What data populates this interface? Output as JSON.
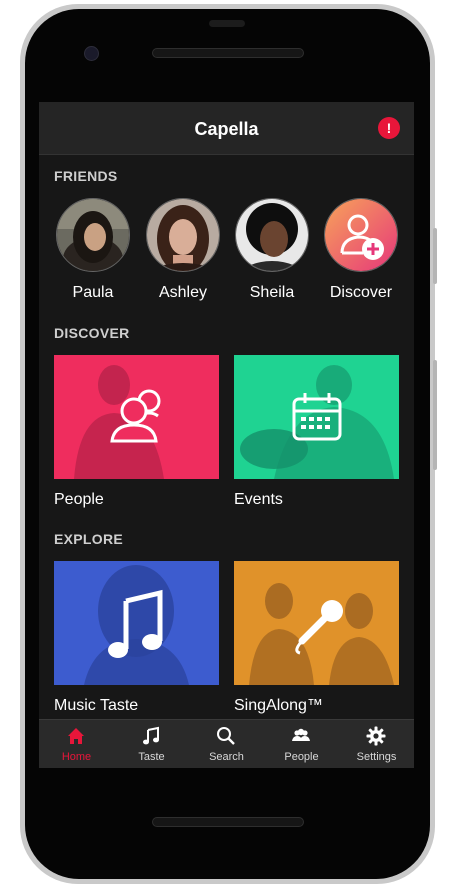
{
  "app": {
    "title": "Capella",
    "alert_symbol": "!"
  },
  "sections": {
    "friends": "FRIENDS",
    "discover": "DISCOVER",
    "explore": "EXPLORE"
  },
  "friends": [
    {
      "name": "Paula"
    },
    {
      "name": "Ashley"
    },
    {
      "name": "Sheila"
    },
    {
      "name": "Discover"
    }
  ],
  "discover_tiles": [
    {
      "label": "People",
      "color": "#ef2d5e"
    },
    {
      "label": "Events",
      "color": "#1fd392"
    }
  ],
  "explore_tiles": [
    {
      "label": "Music Taste",
      "color": "#3d5ccf"
    },
    {
      "label": "SingAlong™",
      "color": "#e0922a"
    }
  ],
  "tabs": [
    {
      "label": "Home",
      "icon": "home-icon",
      "active": true
    },
    {
      "label": "Taste",
      "icon": "music-note-icon"
    },
    {
      "label": "Search",
      "icon": "search-icon"
    },
    {
      "label": "People",
      "icon": "people-icon"
    },
    {
      "label": "Settings",
      "icon": "gear-icon"
    }
  ],
  "colors": {
    "accent": "#e8163a",
    "background": "#171717",
    "header": "#252525"
  }
}
